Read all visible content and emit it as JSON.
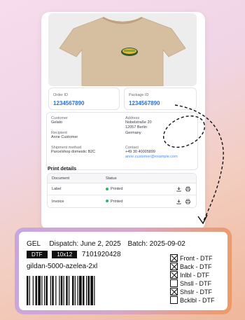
{
  "order": {
    "label": "Order ID",
    "value": "1234567890"
  },
  "package": {
    "label": "Package ID",
    "value": "1234567890"
  },
  "customer": {
    "label": "Customer",
    "value": "Gelato"
  },
  "recipient": {
    "label": "Recipient",
    "value": "Anne Customer"
  },
  "shipment": {
    "label": "Shipment method",
    "value": "Parcelshop domestic B2C"
  },
  "address": {
    "label": "Address",
    "line1": "Nobelstraße 20",
    "line2": "12057 Berlin",
    "line3": "Germany"
  },
  "contact": {
    "label": "Contact",
    "phone": "+49 30 40005899",
    "email": "anne.customer@example.com"
  },
  "print_details": {
    "title": "Print details",
    "headers": [
      "Document",
      "Status"
    ],
    "rows": [
      {
        "document": "Label",
        "status": "Printed"
      },
      {
        "document": "Invoice",
        "status": "Printed"
      }
    ]
  },
  "label": {
    "code": "GEL",
    "dispatch": "Dispatch: June 2, 2025",
    "batch": "Batch: 2025-09-02",
    "tag1": "DTF",
    "tag2": "10x12",
    "number": "7101920428",
    "sku": "gildan-5000-azelea-2xl",
    "options": [
      {
        "text": "Front - DTF",
        "checked": true
      },
      {
        "text": "Back - DTF",
        "checked": true
      },
      {
        "text": "Inlbl - DTF",
        "checked": true
      },
      {
        "text": "Shsll - DTF",
        "checked": false
      },
      {
        "text": "Shslr - DTF",
        "checked": true
      },
      {
        "text": "Bcklbl - DTF",
        "checked": false
      }
    ]
  },
  "colors": {
    "accent": "#2f6fdc",
    "printed": "#2fb46e",
    "shirt": "#d7bfa2"
  }
}
